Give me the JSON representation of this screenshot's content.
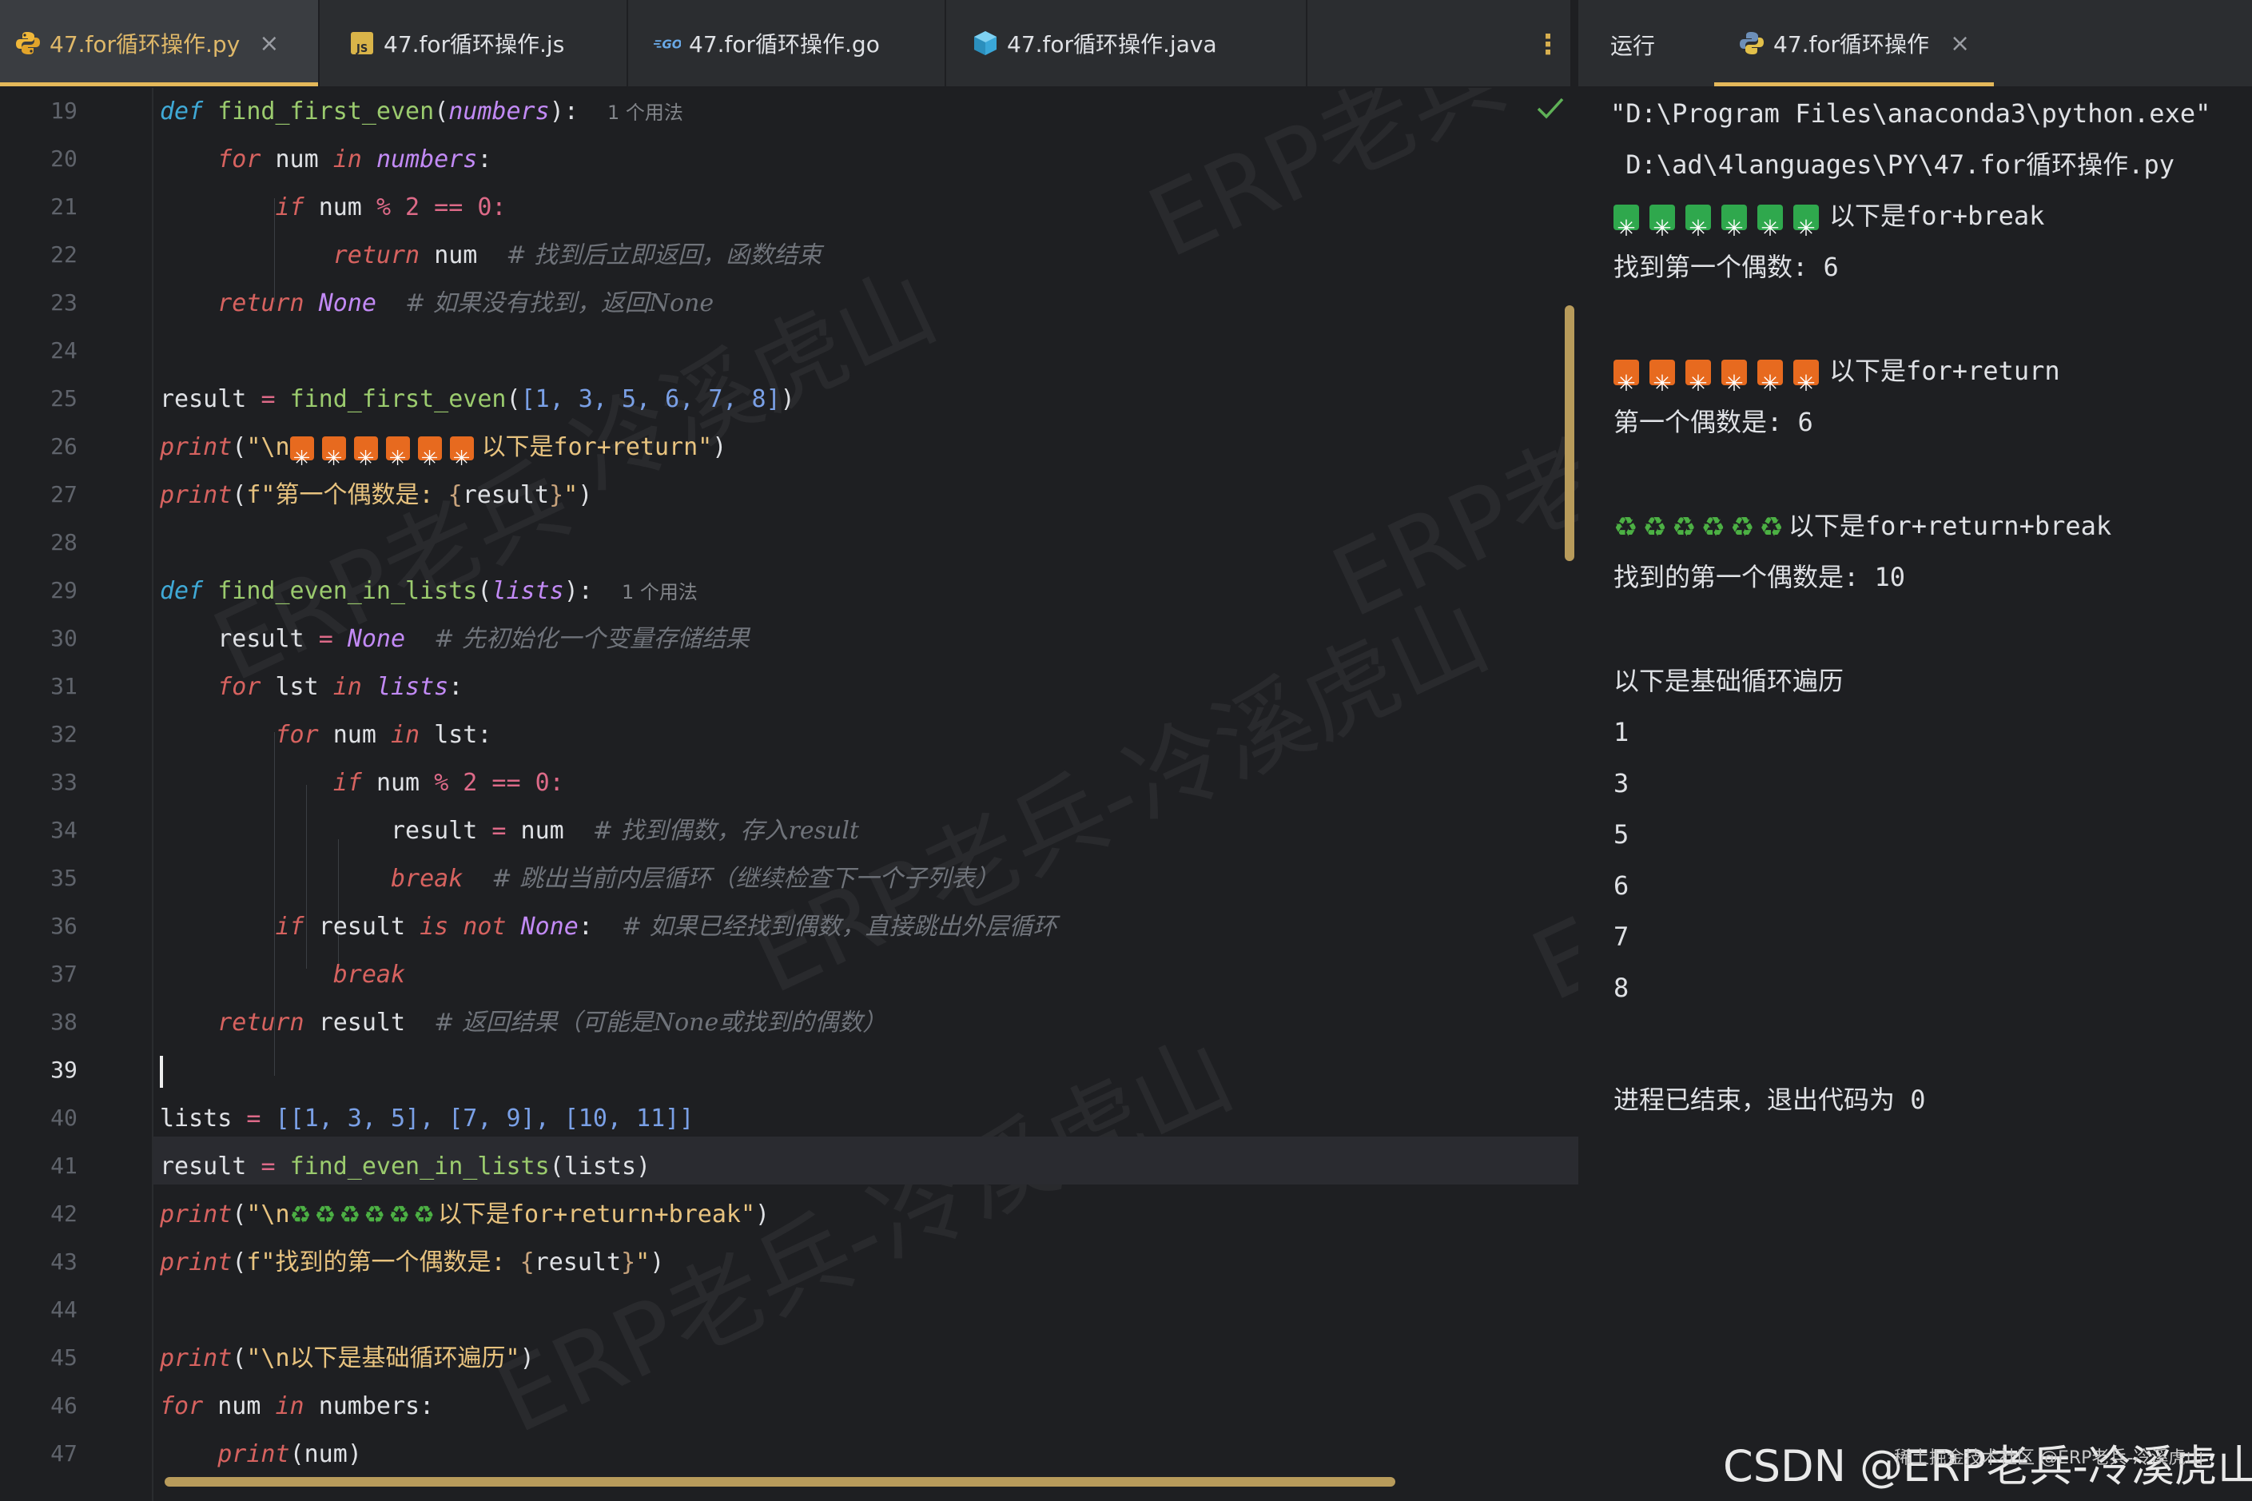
{
  "tabs": [
    {
      "label": "47.for循环操作.py",
      "icon": "python-icon",
      "active": true,
      "close": "×"
    },
    {
      "label": "47.for循环操作.js",
      "icon": "js-file-icon",
      "active": false
    },
    {
      "label": "47.for循环操作.go",
      "icon": "go-file-icon",
      "active": false
    },
    {
      "label": "47.for循环操作.java",
      "icon": "java-file-icon",
      "active": false
    }
  ],
  "more_menu": "⋮",
  "run_panel": {
    "label": "运行",
    "tab_label": "47.for循环操作",
    "tab_close": "×"
  },
  "editor": {
    "first_line": 19,
    "current_line": 39,
    "line_numbers": [
      "19",
      "20",
      "21",
      "22",
      "23",
      "24",
      "25",
      "26",
      "27",
      "28",
      "29",
      "30",
      "31",
      "32",
      "33",
      "34",
      "35",
      "36",
      "37",
      "38",
      "39",
      "40",
      "41",
      "42",
      "43",
      "44",
      "45",
      "46",
      "47"
    ],
    "usage_hint": "1 个用法",
    "tokens": {
      "def": "def",
      "for": "for",
      "in": "in",
      "if": "if",
      "return": "return",
      "None": "None",
      "break": "break",
      "is_not": "is not",
      "print": "print",
      "fn1": "find_first_even",
      "fn2": "find_even_in_lists",
      "numbers": "numbers",
      "lists": "lists",
      "num": "num",
      "lst": "lst",
      "result": "result",
      "cmt22": "# 找到后立即返回，函数结束",
      "cmt23": "# 如果没有找到，返回None",
      "cmt30": "# 先初始化一个变量存储结果",
      "cmt34": "# 找到偶数，存入result",
      "cmt35": "# 跳出当前内层循环（继续检查下一个子列表）",
      "cmt36": "# 如果已经找到偶数，直接跳出外层循环",
      "cmt38": "# 返回结果（可能是None或找到的偶数）",
      "str26_a": "\"\\n",
      "str26_b": "以下是for+return\"",
      "str27": "f\"第一个偶数是: ",
      "str42_a": "\"\\n",
      "str42_b": "以下是for+return+break\"",
      "str43": "f\"找到的第一个偶数是: ",
      "str45": "\"\\n以下是基础循环遍历\"",
      "str_close": "\"",
      "mod2": "% 2 == 0:",
      "list25": "[1, 3, 5, 6, 7, 8]",
      "list40": "[[1, 3, 5], [7, 9], [10, 11]]"
    }
  },
  "console": {
    "cmd_line1": "\"D:\\Program Files\\anaconda3\\python.exe\"",
    "cmd_line2": " D:\\ad\\4languages\\PY\\47.for循环操作.py",
    "sections": [
      {
        "badge": "green",
        "count": 6,
        "header": "以下是for+break",
        "result": "找到第一个偶数: 6"
      },
      {
        "badge": "orange",
        "count": 6,
        "header": "以下是for+return",
        "result": "第一个偶数是: 6"
      },
      {
        "badge": "recycle",
        "count": 6,
        "header": "以下是for+return+break",
        "result": "找到的第一个偶数是: 10"
      }
    ],
    "loop_header": "以下是基础循环遍历",
    "loop_values": [
      "1",
      "3",
      "5",
      "6",
      "7",
      "8"
    ],
    "exit_message": "进程已结束，退出代码为 0"
  },
  "watermark": {
    "text1": "ERP老兵",
    "text2": "冷溪虎山",
    "text3": "ERP老兵-冷溪虎山"
  },
  "footer": {
    "csdn": "CSDN @ERP老兵-冷溪虎山",
    "small": "稀土掘金技术社区 @ERP老兵-冷溪虎山"
  },
  "colors": {
    "accent": "#e4b85a",
    "keyword": "#d6625f",
    "function": "#9bcb6e",
    "string": "#e8c37f",
    "number": "#7aa0e6",
    "comment": "#6f737a",
    "builtin_const": "#c28af5",
    "background": "#1e1f22"
  }
}
